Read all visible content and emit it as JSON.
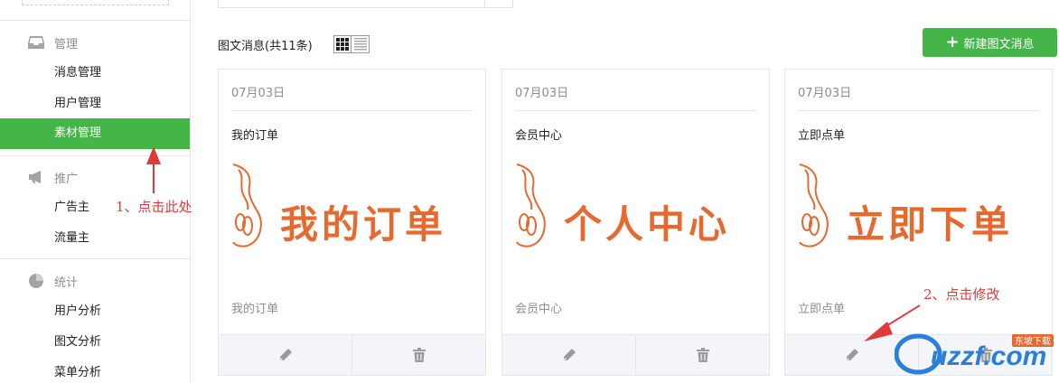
{
  "sidebar": {
    "sections": [
      {
        "title": "管理",
        "icon": "inbox-icon",
        "items": [
          "消息管理",
          "用户管理",
          "素材管理"
        ]
      },
      {
        "title": "推广",
        "icon": "megaphone-icon",
        "items": [
          "广告主",
          "流量主"
        ]
      },
      {
        "title": "统计",
        "icon": "pie-chart-icon",
        "items": [
          "用户分析",
          "图文分析",
          "菜单分析"
        ]
      }
    ],
    "active_item": "素材管理"
  },
  "main": {
    "list_title": "图文消息(共11条)",
    "new_button": "新建图文消息",
    "cards": [
      {
        "date": "07月03日",
        "title": "我的订单",
        "cover_text": "我的订单",
        "digest": "我的订单"
      },
      {
        "date": "07月03日",
        "title": "会员中心",
        "cover_text": "个人中心",
        "digest": "会员中心"
      },
      {
        "date": "07月03日",
        "title": "立即点单",
        "cover_text": "立即下单",
        "digest": "立即点单"
      }
    ]
  },
  "annotations": {
    "step1": "1、点击此处",
    "step2": "2、点击修改",
    "color": "#e03b3b"
  },
  "watermark": {
    "text": "uzzf.com",
    "badge": "东坡下载"
  },
  "colors": {
    "accent": "#44b549",
    "cover_text": "#e8692d"
  }
}
